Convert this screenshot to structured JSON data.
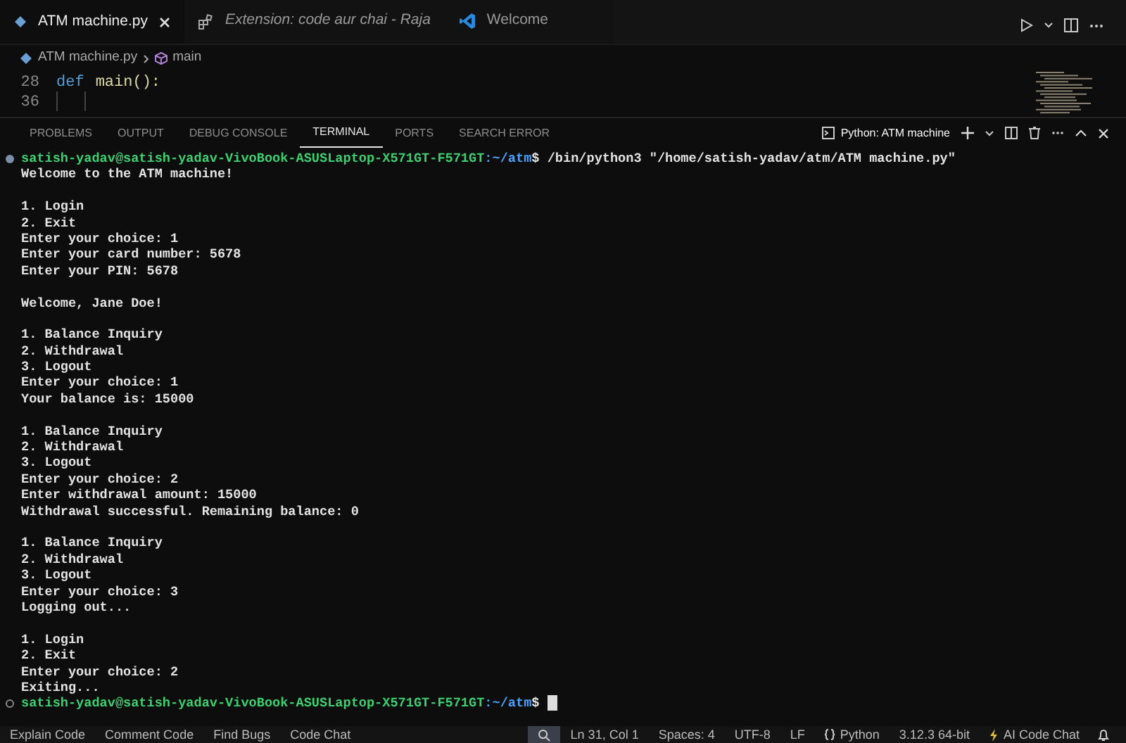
{
  "editor_tabs": [
    {
      "label": "ATM machine.py",
      "selected": true
    },
    {
      "label": "Extension: code aur chai - Raja",
      "selected": false
    },
    {
      "label": "Welcome",
      "selected": false
    }
  ],
  "breadcrumb": [
    "ATM machine.py",
    "main"
  ],
  "code_lines": [
    {
      "number": "28",
      "tokens": [
        {
          "text": "def",
          "kind": "keyword"
        },
        {
          "text": "main",
          "kind": "function"
        },
        {
          "text": "():",
          "kind": "plain"
        }
      ]
    },
    {
      "number": "36"
    }
  ],
  "panel_tabs": [
    {
      "label": "PROBLEMS",
      "selected": false
    },
    {
      "label": "OUTPUT",
      "selected": false
    },
    {
      "label": "DEBUG CONSOLE",
      "selected": false
    },
    {
      "label": "TERMINAL",
      "selected": true
    },
    {
      "label": "PORTS",
      "selected": false
    },
    {
      "label": "SEARCH ERROR",
      "selected": false
    }
  ],
  "terminal_name": "Python: ATM machine",
  "terminal_lines": [
    {
      "kind": "prompt",
      "finished": true,
      "user_host": "satish-yadav@satish-yadav-VivoBook-ASUSLaptop-X571GT-F571GT",
      "path": ":~/atm",
      "symbol": "$",
      "command": "/bin/python3 \"/home/satish-yadav/atm/ATM machine.py\""
    },
    {
      "kind": "output",
      "text": "Welcome to the ATM machine!"
    },
    {
      "kind": "blank"
    },
    {
      "kind": "output",
      "text": "1. Login"
    },
    {
      "kind": "output",
      "text": "2. Exit"
    },
    {
      "kind": "output",
      "text": "Enter your choice: 1"
    },
    {
      "kind": "output",
      "text": "Enter your card number: 5678"
    },
    {
      "kind": "output",
      "text": "Enter your PIN: 5678"
    },
    {
      "kind": "blank"
    },
    {
      "kind": "output",
      "text": "Welcome, Jane Doe!"
    },
    {
      "kind": "blank"
    },
    {
      "kind": "output",
      "text": "1. Balance Inquiry"
    },
    {
      "kind": "output",
      "text": "2. Withdrawal"
    },
    {
      "kind": "output",
      "text": "3. Logout"
    },
    {
      "kind": "output",
      "text": "Enter your choice: 1"
    },
    {
      "kind": "output",
      "text": "Your balance is: 15000"
    },
    {
      "kind": "blank"
    },
    {
      "kind": "output",
      "text": "1. Balance Inquiry"
    },
    {
      "kind": "output",
      "text": "2. Withdrawal"
    },
    {
      "kind": "output",
      "text": "3. Logout"
    },
    {
      "kind": "output",
      "text": "Enter your choice: 2"
    },
    {
      "kind": "output",
      "text": "Enter withdrawal amount: 15000"
    },
    {
      "kind": "output",
      "text": "Withdrawal successful. Remaining balance: 0"
    },
    {
      "kind": "blank"
    },
    {
      "kind": "output",
      "text": "1. Balance Inquiry"
    },
    {
      "kind": "output",
      "text": "2. Withdrawal"
    },
    {
      "kind": "output",
      "text": "3. Logout"
    },
    {
      "kind": "output",
      "text": "Enter your choice: 3"
    },
    {
      "kind": "output",
      "text": "Logging out..."
    },
    {
      "kind": "blank"
    },
    {
      "kind": "output",
      "text": "1. Login"
    },
    {
      "kind": "output",
      "text": "2. Exit"
    },
    {
      "kind": "output",
      "text": "Enter your choice: 2"
    },
    {
      "kind": "output",
      "text": "Exiting..."
    },
    {
      "kind": "prompt",
      "finished": false,
      "user_host": "satish-yadav@satish-yadav-VivoBook-ASUSLaptop-X571GT-F571GT",
      "path": ":~/atm",
      "symbol": "$"
    }
  ],
  "status_left": [
    "Explain Code",
    "Comment Code",
    "Find Bugs",
    "Code Chat"
  ],
  "status_right": [
    {
      "kind": "zoom"
    },
    {
      "kind": "text",
      "text": "Ln 31, Col 1"
    },
    {
      "kind": "text",
      "text": "Spaces: 4"
    },
    {
      "kind": "text",
      "text": "UTF-8"
    },
    {
      "kind": "text",
      "text": "LF"
    },
    {
      "kind": "language",
      "text": "Python"
    },
    {
      "kind": "text",
      "text": "3.12.3 64-bit"
    },
    {
      "kind": "ai",
      "text": "AI Code Chat"
    },
    {
      "kind": "bell"
    }
  ]
}
